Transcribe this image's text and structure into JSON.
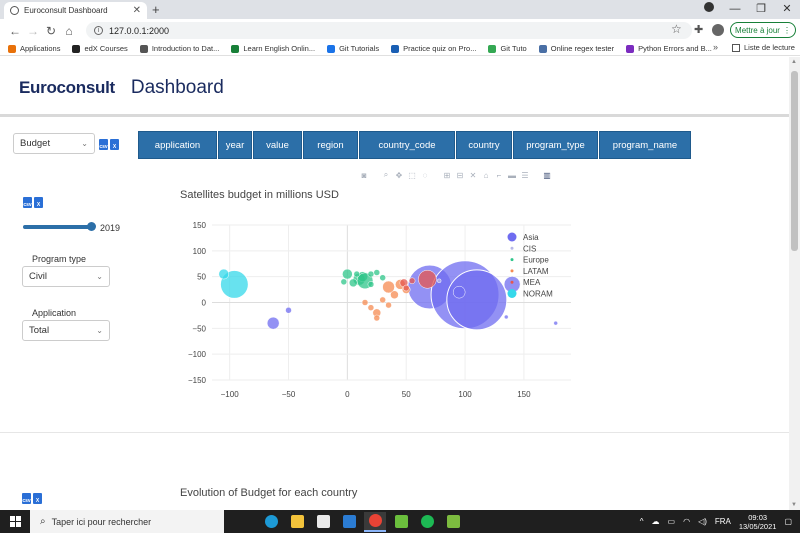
{
  "browser": {
    "tab_title": "Euroconsult Dashboard",
    "url": "127.0.0.1:2000",
    "update_label": "Mettre à jour",
    "bookmarks": [
      {
        "label": "Applications",
        "color": "#e8710a"
      },
      {
        "label": "edX Courses",
        "color": "#222222"
      },
      {
        "label": "Introduction to Dat...",
        "color": "#555555"
      },
      {
        "label": "Learn English Onlin...",
        "color": "#188038"
      },
      {
        "label": "Git Tutorials",
        "color": "#1a73e8"
      },
      {
        "label": "Practice quiz on Pro...",
        "color": "#1a5fb4"
      },
      {
        "label": "Git Tuto",
        "color": "#34a853"
      },
      {
        "label": "Online regex tester",
        "color": "#4a6fa5"
      },
      {
        "label": "Python Errors and B...",
        "color": "#7b2cbf"
      }
    ],
    "more": "»",
    "reading_list": "Liste de lecture"
  },
  "header": {
    "logo": "Euroconsult",
    "title": "Dashboard"
  },
  "controls": {
    "measure_select": "Budget",
    "column_buttons": [
      "application",
      "year",
      "value",
      "region",
      "country_code",
      "country",
      "program_type",
      "program_name"
    ]
  },
  "sidebar": {
    "slider_value": "2019",
    "program_type_label": "Program type",
    "program_type_value": "Civil",
    "application_label": "Application",
    "application_value": "Total"
  },
  "chart1": {
    "title": "Satellites budget in millions USD"
  },
  "chart2": {
    "title": "Evolution of Budget for each country"
  },
  "chart_data": {
    "type": "scatter",
    "title": "Satellites budget in millions USD",
    "xlabel": "",
    "ylabel": "",
    "xlim": [
      -115,
      190
    ],
    "ylim": [
      -150,
      150
    ],
    "xticks": [
      -100,
      -50,
      0,
      50,
      100,
      150
    ],
    "yticks": [
      150,
      100,
      50,
      0,
      -50,
      -100,
      -150
    ],
    "grid": true,
    "legend_position": "right",
    "series": [
      {
        "name": "Asia",
        "color": "#6f6cf0",
        "points": [
          {
            "x": 70,
            "y": 30,
            "s": 22
          },
          {
            "x": 100,
            "y": 15,
            "s": 34
          },
          {
            "x": 110,
            "y": 5,
            "s": 30
          },
          {
            "x": 140,
            "y": 35,
            "s": 8
          },
          {
            "x": 135,
            "y": -28,
            "s": 2
          },
          {
            "x": -63,
            "y": -40,
            "s": 6
          },
          {
            "x": -50,
            "y": -15,
            "s": 3
          },
          {
            "x": 177,
            "y": -40,
            "s": 2
          },
          {
            "x": 95,
            "y": 20,
            "s": 6
          }
        ]
      },
      {
        "name": "CIS",
        "color": "#b8b8e8",
        "points": [
          {
            "x": 78,
            "y": 42,
            "s": 2
          }
        ]
      },
      {
        "name": "Europe",
        "color": "#2fc58a",
        "points": [
          {
            "x": 0,
            "y": 55,
            "s": 5
          },
          {
            "x": 10,
            "y": 45,
            "s": 6
          },
          {
            "x": 13,
            "y": 50,
            "s": 5
          },
          {
            "x": 15,
            "y": 42,
            "s": 8
          },
          {
            "x": 5,
            "y": 38,
            "s": 4
          },
          {
            "x": 20,
            "y": 55,
            "s": 3
          },
          {
            "x": 25,
            "y": 58,
            "s": 3
          },
          {
            "x": -3,
            "y": 40,
            "s": 3
          },
          {
            "x": 30,
            "y": 48,
            "s": 3
          },
          {
            "x": 20,
            "y": 35,
            "s": 3
          },
          {
            "x": 8,
            "y": 55,
            "s": 3
          }
        ]
      },
      {
        "name": "LATAM",
        "color": "#f58b52",
        "points": [
          {
            "x": 35,
            "y": 30,
            "s": 6
          },
          {
            "x": 45,
            "y": 35,
            "s": 5
          },
          {
            "x": 40,
            "y": 15,
            "s": 4
          },
          {
            "x": 25,
            "y": -20,
            "s": 4
          },
          {
            "x": 20,
            "y": -10,
            "s": 3
          },
          {
            "x": 15,
            "y": 0,
            "s": 3
          },
          {
            "x": 30,
            "y": 5,
            "s": 3
          },
          {
            "x": 35,
            "y": -5,
            "s": 3
          },
          {
            "x": 25,
            "y": -30,
            "s": 3
          },
          {
            "x": 50,
            "y": 25,
            "s": 4
          }
        ]
      },
      {
        "name": "MEA",
        "color": "#e5574f",
        "points": [
          {
            "x": 68,
            "y": 45,
            "s": 9
          },
          {
            "x": 48,
            "y": 38,
            "s": 4
          },
          {
            "x": 50,
            "y": 28,
            "s": 3
          },
          {
            "x": 55,
            "y": 42,
            "s": 3
          }
        ]
      },
      {
        "name": "NORAM",
        "color": "#35d8ea",
        "points": [
          {
            "x": -96,
            "y": 35,
            "s": 14
          },
          {
            "x": -105,
            "y": 55,
            "s": 5
          }
        ]
      }
    ]
  }
}
